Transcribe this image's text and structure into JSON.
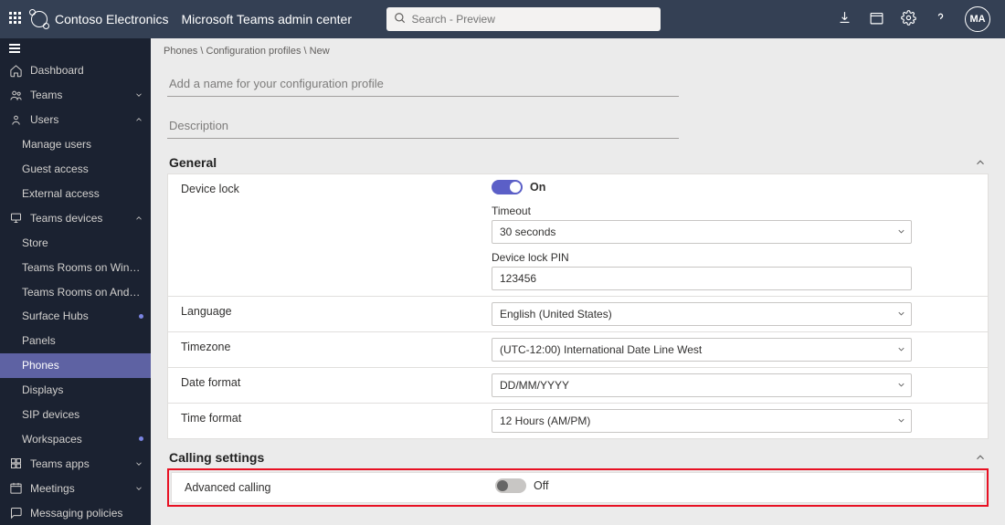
{
  "header": {
    "brand": "Contoso Electronics",
    "app": "Microsoft Teams admin center",
    "search_placeholder": "Search - Preview",
    "avatar": "MA"
  },
  "sidebar": {
    "items": [
      {
        "icon": "home",
        "label": "Dashboard",
        "type": "item"
      },
      {
        "icon": "teams",
        "label": "Teams",
        "type": "collapse",
        "state": "collapsed"
      },
      {
        "icon": "users",
        "label": "Users",
        "type": "collapse",
        "state": "expanded"
      },
      {
        "label": "Manage users",
        "type": "sub"
      },
      {
        "label": "Guest access",
        "type": "sub"
      },
      {
        "label": "External access",
        "type": "sub"
      },
      {
        "icon": "devices",
        "label": "Teams devices",
        "type": "collapse",
        "state": "expanded"
      },
      {
        "label": "Store",
        "type": "sub"
      },
      {
        "label": "Teams Rooms on Windo...",
        "type": "sub"
      },
      {
        "label": "Teams Rooms on Android",
        "type": "sub"
      },
      {
        "label": "Surface Hubs",
        "type": "sub",
        "badge": true
      },
      {
        "label": "Panels",
        "type": "sub"
      },
      {
        "label": "Phones",
        "type": "sub",
        "active": true
      },
      {
        "label": "Displays",
        "type": "sub"
      },
      {
        "label": "SIP devices",
        "type": "sub"
      },
      {
        "label": "Workspaces",
        "type": "sub",
        "badge": true
      },
      {
        "icon": "apps",
        "label": "Teams apps",
        "type": "collapse",
        "state": "collapsed"
      },
      {
        "icon": "meetings",
        "label": "Meetings",
        "type": "collapse",
        "state": "collapsed"
      },
      {
        "icon": "messaging",
        "label": "Messaging policies",
        "type": "item"
      }
    ]
  },
  "breadcrumb": {
    "parts": [
      "Phones",
      "Configuration profiles",
      "New"
    ]
  },
  "form": {
    "name_placeholder": "Add a name for your configuration profile",
    "description_placeholder": "Description"
  },
  "general": {
    "title": "General",
    "device_lock": {
      "label": "Device lock",
      "state": "On",
      "timeout_label": "Timeout",
      "timeout_value": "30 seconds",
      "pin_label": "Device lock PIN",
      "pin_value": "123456"
    },
    "language": {
      "label": "Language",
      "value": "English (United States)"
    },
    "timezone": {
      "label": "Timezone",
      "value": "(UTC-12:00) International Date Line West"
    },
    "date_format": {
      "label": "Date format",
      "value": "DD/MM/YYYY"
    },
    "time_format": {
      "label": "Time format",
      "value": "12 Hours (AM/PM)"
    }
  },
  "calling": {
    "title": "Calling settings",
    "advanced": {
      "label": "Advanced calling",
      "state": "Off"
    }
  }
}
